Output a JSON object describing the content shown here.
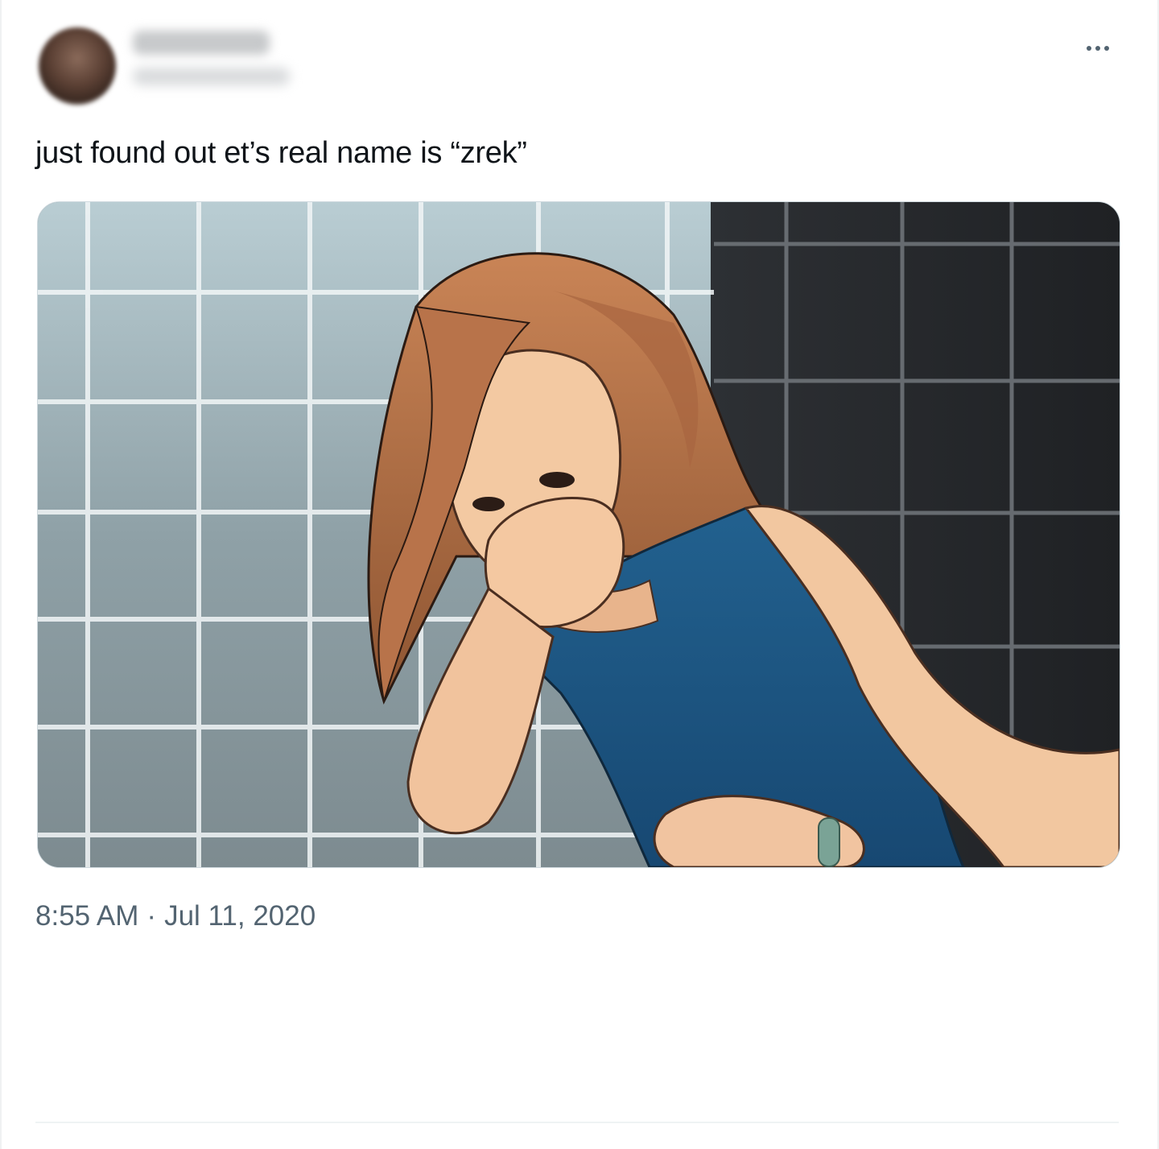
{
  "tweet": {
    "author": {
      "display_name": "",
      "handle": ""
    },
    "text": "just found out et’s real name is “zrek”",
    "media": {
      "description": "",
      "type": "image"
    },
    "time": "8:55 AM",
    "separator": "·",
    "date": "Jul 11, 2020",
    "more_icon": "more-horizontal-icon"
  },
  "colors": {
    "text_primary": "#0f1419",
    "text_secondary": "#536471",
    "border": "#cfd9de"
  }
}
